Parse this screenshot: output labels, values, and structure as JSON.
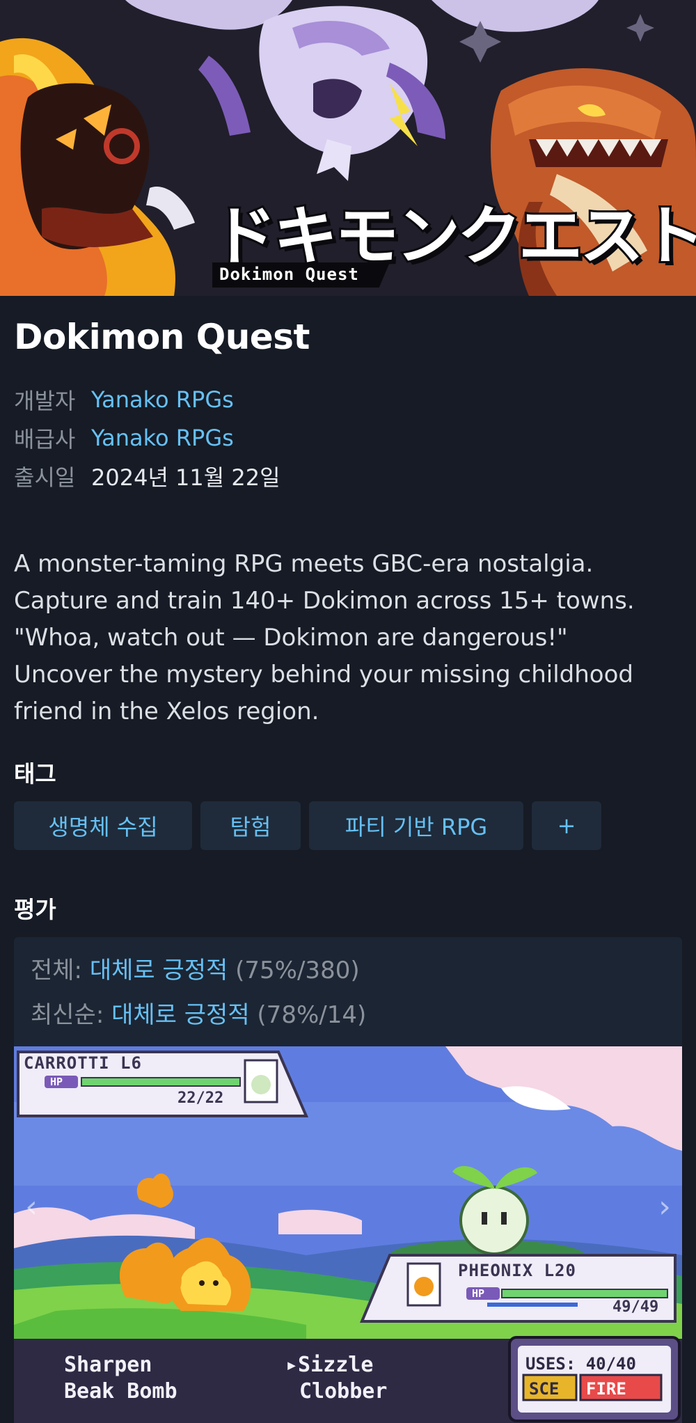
{
  "hero": {
    "logo_text_jp": "ドキモンクエスト",
    "logo_text_en": "Dokimon Quest"
  },
  "game": {
    "title": "Dokimon Quest",
    "developer_label": "개발자",
    "developer": "Yanako RPGs",
    "publisher_label": "배급사",
    "publisher": "Yanako RPGs",
    "release_label": "출시일",
    "release_date": "2024년 11월 22일",
    "description": [
      "A monster-taming RPG meets GBC-era nostalgia.",
      "Capture and train 140+ Dokimon across 15+ towns.",
      "\"Whoa, watch out — Dokimon are dangerous!\"",
      "Uncover the mystery behind your missing childhood",
      "friend in the Xelos region."
    ]
  },
  "tags": {
    "heading": "태그",
    "items": [
      "생명체 수집",
      "탐험",
      "파티 기반 RPG",
      "+"
    ]
  },
  "reviews": {
    "heading": "평가",
    "overall_label": "전체:",
    "overall_summary": "대체로 긍정적",
    "overall_detail": "(75%/380)",
    "recent_label": "최신순:",
    "recent_summary": "대체로 긍정적",
    "recent_detail": "(78%/14)"
  },
  "screenshot": {
    "enemy_name": "CARROTTI L6",
    "enemy_hp": "22/22",
    "enemy_hp_fraction": 1.0,
    "player_name": "PHEONIX L20",
    "player_hp": "49/49",
    "player_hp_fraction": 1.0,
    "hp_tag": "HP",
    "moves": [
      "Sharpen",
      "Beak Bomb",
      "▸Sizzle",
      "Clobber"
    ],
    "uses": "USES: 40/40",
    "type_left": "SCE",
    "type_right": "FIRE",
    "prev_icon": "chevron-left-icon",
    "next_icon": "chevron-right-icon"
  },
  "colors": {
    "background": "#161b25",
    "link": "#66c0f4",
    "tag_bg": "#1f2b3a",
    "review_bg": "#1c2533"
  }
}
